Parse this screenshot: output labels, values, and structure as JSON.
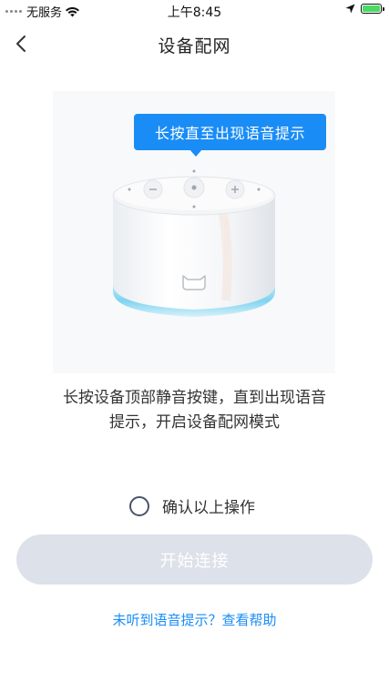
{
  "status_bar": {
    "carrier": "无服务",
    "time": "上午8:45",
    "icons": [
      "wifi-icon",
      "location-arrow-icon",
      "battery-charging-icon"
    ],
    "battery_color": "#4cd964"
  },
  "nav": {
    "back_icon": "chevron-left-icon",
    "title": "设备配网"
  },
  "illustration": {
    "bubble_text": "长按直至出现语音提示",
    "device_image": "smart-speaker-illustration"
  },
  "instruction": {
    "line1": "长按设备顶部静音按键，直到出现语音",
    "line2": "提示，开启设备配网模式"
  },
  "confirm": {
    "label": "确认以上操作",
    "checked": false
  },
  "start_button": {
    "label": "开始连接",
    "enabled": false
  },
  "help_link": {
    "label": "未听到语音提示？查看帮助"
  },
  "colors": {
    "accent": "#1a8cf6",
    "button_disabled": "#dde1ea",
    "speaker_glow": "#7fd3f0"
  }
}
